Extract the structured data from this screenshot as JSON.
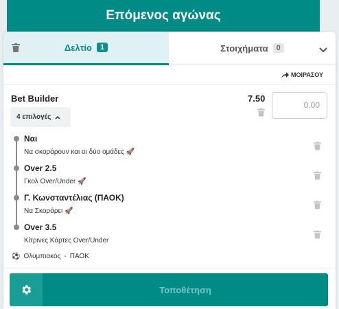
{
  "banner": {
    "title": "Επόμενος αγώνας"
  },
  "tabs": {
    "betslip": {
      "label": "Δελτίο",
      "count": "1"
    },
    "bets": {
      "label": "Στοιχήματα",
      "count": "0"
    }
  },
  "share": {
    "label": "ΜΟΙΡΑΣΟΥ"
  },
  "bet_builder": {
    "title": "Bet Builder",
    "odds": "7.50",
    "stake_placeholder": "0.00",
    "selections_toggle": "4 επιλογές"
  },
  "selections": [
    {
      "name": "Ναι",
      "market": "Να σκοράρουν και οι δύο ομάδες"
    },
    {
      "name": "Over 2.5",
      "market": "Γκολ Over/Under"
    },
    {
      "name": "Γ. Κωνσταντέλιας (ΠΑΟΚ)",
      "market": "Να Σκοράρει"
    },
    {
      "name": "Over 3.5",
      "market": "Κίτρινες Κάρτες Over/Under"
    }
  ],
  "match": {
    "home": "Ολυμπιακός",
    "separator": "-",
    "away": "ΠΑΟΚ"
  },
  "footer": {
    "place_label": "Τοποθέτηση"
  },
  "colors": {
    "brand": "#008b87",
    "tab_active_bg": "#dff1f3",
    "place_disabled_text": "#7ac4c1"
  },
  "icons": [
    "trash-icon",
    "chevron-down-icon",
    "share-arrow-icon",
    "chevron-up-icon",
    "rocket-icon",
    "soccer-ball-icon",
    "gear-icon"
  ]
}
